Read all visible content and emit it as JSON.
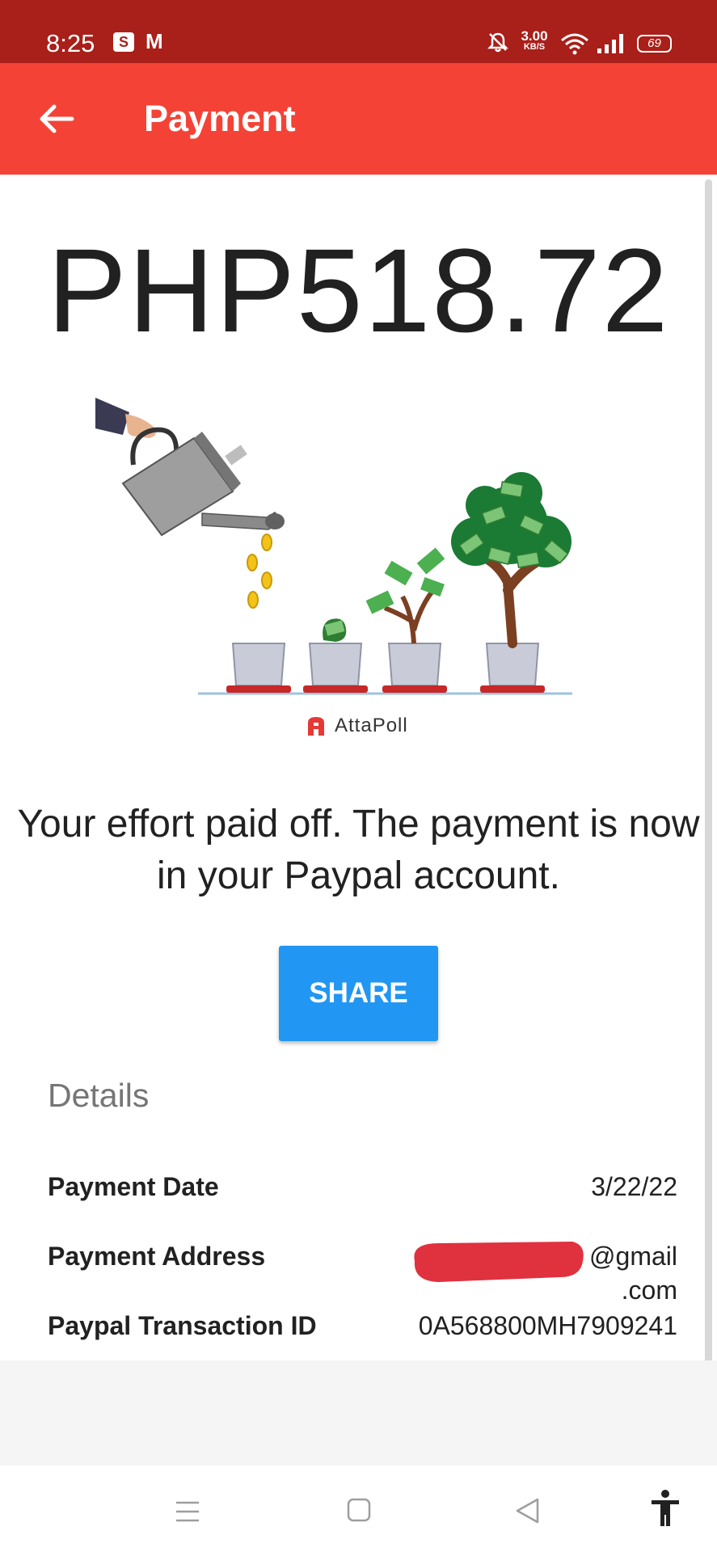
{
  "status_bar": {
    "time": "8:25",
    "notif_s": "S",
    "notif_m": "M",
    "speed_value": "3.00",
    "speed_unit": "KB/S",
    "battery": "69",
    "color": "#a91f19"
  },
  "app_bar": {
    "title": "Payment",
    "color": "#f44336",
    "back_icon": "arrow-left-icon"
  },
  "payment": {
    "amount": "PHP518.72",
    "brand": "AttaPoll",
    "message": "Your effort paid off. The payment is now in your Paypal account.",
    "share_label": "SHARE",
    "share_color": "#2196f3"
  },
  "details": {
    "heading": "Details",
    "rows": [
      {
        "label": "Payment Date",
        "value": "3/22/22"
      },
      {
        "label": "Payment Address",
        "value_line1": "@gmail",
        "value_line2": ".com",
        "redacted": true
      },
      {
        "label": "Paypal Transaction ID",
        "value": "0A568800MH7909241"
      }
    ]
  },
  "nav": {
    "icons": [
      "menu-icon",
      "home-square-icon",
      "back-triangle-icon",
      "accessibility-icon"
    ]
  }
}
